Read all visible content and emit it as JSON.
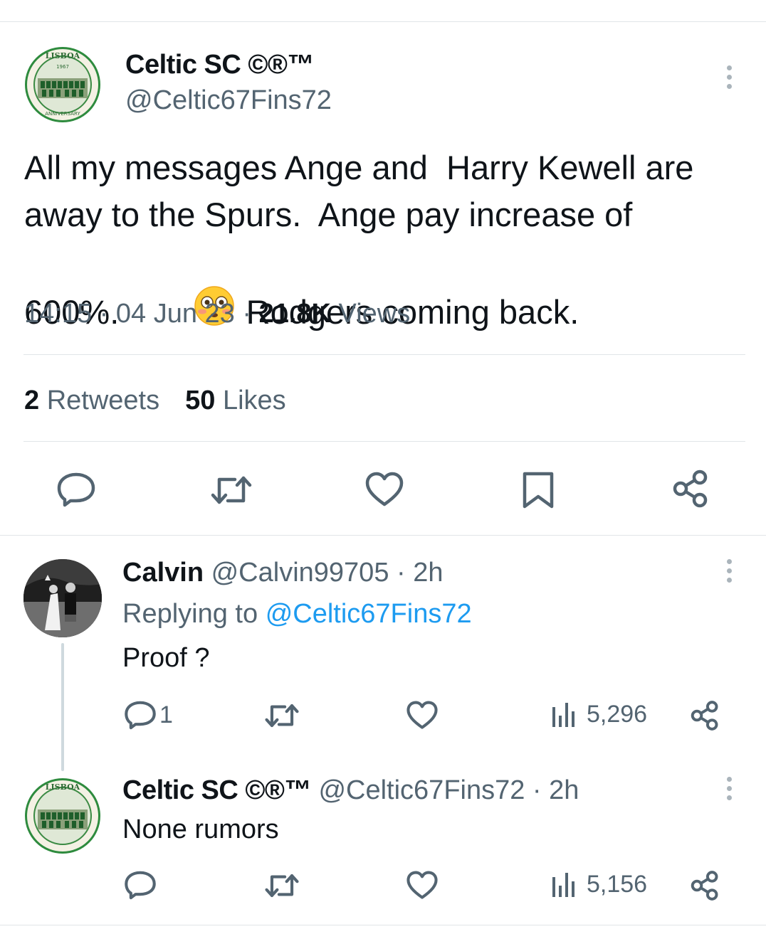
{
  "main_tweet": {
    "display_name": "Celtic SC ©®™",
    "handle": "@Celtic67Fins72",
    "text_line1": "All my messages Ange and  Harry Kewell are",
    "text_line2": "away to the Spurs.  Ange pay increase of",
    "text_line3a": "600%.",
    "emoji_icon": "flushed-face-emoji",
    "text_line3b": "Rodgers coming back.",
    "time": "14:15",
    "date": "04 Jun 23",
    "views_count": "21.8K",
    "views_label": "Views",
    "retweets_count": "2",
    "retweets_label": "Retweets",
    "likes_count": "50",
    "likes_label": "Likes",
    "avatar_text": "LISBOA",
    "avatar_year": "1967"
  },
  "reply1": {
    "display_name": "Calvin",
    "handle": "@Calvin99705",
    "time": "2h",
    "replying_prefix": "Replying to",
    "replying_handle": "@Celtic67Fins72",
    "text": "Proof ?",
    "reply_count": "1",
    "views": "5,296"
  },
  "reply2": {
    "display_name": "Celtic SC ©®™",
    "handle": "@Celtic67Fins72",
    "time": "2h",
    "text": "None rumors",
    "views": "5,156",
    "avatar_text": "LISBOA"
  },
  "colors": {
    "accent": "#1d9bf0",
    "muted": "#536471",
    "icon": "#536471",
    "divider": "#e1e5e8"
  }
}
